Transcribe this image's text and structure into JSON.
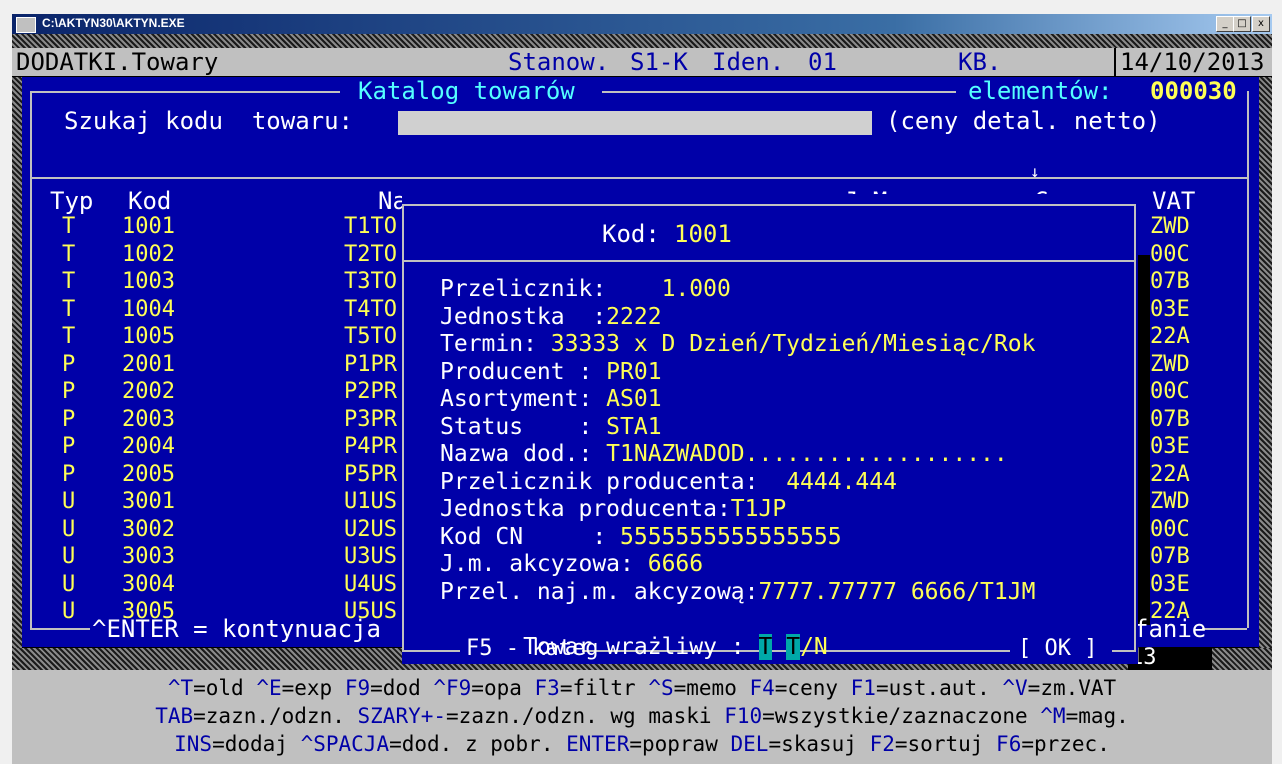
{
  "window": {
    "title": "C:\\AKTYN30\\AKTYN.EXE",
    "minimize_label": "_",
    "maximize_label": "□",
    "close_label": "x"
  },
  "status_bar": {
    "module": "DODATKI.Towary",
    "station_label": "Stanow.",
    "station": "S1-K",
    "iden_label": "Iden.",
    "iden": "01",
    "user": "KB.",
    "date": "14/10/2013"
  },
  "catalog": {
    "title": "Katalog towarów",
    "elements_label": "elementów:",
    "elements_count": "000030",
    "search_label": "Szukaj kodu  towaru:",
    "search_value": "",
    "price_mode": "(ceny detal. netto)",
    "sort_arrow": "↓",
    "footer_hint": "^ENTER = kontynuacja",
    "footer_right": "fanie",
    "columns": {
      "typ": "Typ",
      "kod": "Kod",
      "nazwa": "Nazwa",
      "jm": "J.M.",
      "cena": "Cena",
      "vat": "VAT"
    },
    "rows": [
      {
        "typ": "T",
        "kod": "1001",
        "nazwa": "T1TO",
        "vat": "ZWD"
      },
      {
        "typ": "T",
        "kod": "1002",
        "nazwa": "T2TO",
        "vat": "00C"
      },
      {
        "typ": "T",
        "kod": "1003",
        "nazwa": "T3TO",
        "vat": "07B"
      },
      {
        "typ": "T",
        "kod": "1004",
        "nazwa": "T4TO",
        "vat": "03E"
      },
      {
        "typ": "T",
        "kod": "1005",
        "nazwa": "T5TO",
        "vat": "22A"
      },
      {
        "typ": "P",
        "kod": "2001",
        "nazwa": "P1PR",
        "vat": "ZWD"
      },
      {
        "typ": "P",
        "kod": "2002",
        "nazwa": "P2PR",
        "vat": "00C"
      },
      {
        "typ": "P",
        "kod": "2003",
        "nazwa": "P3PR",
        "vat": "07B"
      },
      {
        "typ": "P",
        "kod": "2004",
        "nazwa": "P4PR",
        "vat": "03E"
      },
      {
        "typ": "P",
        "kod": "2005",
        "nazwa": "P5PR",
        "vat": "22A"
      },
      {
        "typ": "U",
        "kod": "3001",
        "nazwa": "U1US",
        "vat": "ZWD"
      },
      {
        "typ": "U",
        "kod": "3002",
        "nazwa": "U2US",
        "vat": "00C"
      },
      {
        "typ": "U",
        "kod": "3003",
        "nazwa": "U3US",
        "vat": "07B"
      },
      {
        "typ": "U",
        "kod": "3004",
        "nazwa": "U4US",
        "vat": "03E"
      },
      {
        "typ": "U",
        "kod": "3005",
        "nazwa": "U5US",
        "vat": "22A"
      }
    ],
    "side_value": "13"
  },
  "dialog": {
    "kod_label": "Kod:",
    "kod_value": "1001",
    "fields": [
      {
        "label": "Przelicznik:    ",
        "value": "1.000"
      },
      {
        "label": "Jednostka  :",
        "value": "2222"
      },
      {
        "label": "Termin: ",
        "value": "33333 x D Dzień/Tydzień/Miesiąc/Rok"
      },
      {
        "label": "Producent : ",
        "value": "PR01"
      },
      {
        "label": "Asortyment: ",
        "value": "AS01"
      },
      {
        "label": "Status    : ",
        "value": "STA1"
      },
      {
        "label": "Nazwa dod.: ",
        "value": "T1NAZWADOD..................."
      },
      {
        "label": "Przelicznik producenta:  ",
        "value": "4444.444"
      },
      {
        "label": "Jednostka producenta:",
        "value": "T1JP"
      },
      {
        "label": "Kod CN     : ",
        "value": "5555555555555555"
      },
      {
        "label": "J.m. akcyzowa: ",
        "value": "6666"
      },
      {
        "label": "Przel. naj.m. akcyzową:",
        "value": "7777.77777 6666/T1JM"
      }
    ],
    "sensitive_label": "Towar wrażliwy : ",
    "sensitive_t1": "T",
    "sensitive_t2": "T",
    "sensitive_rest": "/N",
    "footer_left": "F5 - kateg",
    "ok_label": "[ OK ]"
  },
  "help": {
    "lines": [
      [
        {
          "k": "^T",
          "v": "=old "
        },
        {
          "k": "^E",
          "v": "=exp "
        },
        {
          "k": "F9",
          "v": "=dod "
        },
        {
          "k": "^F9",
          "v": "=opa "
        },
        {
          "k": "F3",
          "v": "=filtr "
        },
        {
          "k": "^S",
          "v": "=memo "
        },
        {
          "k": "F4",
          "v": "=ceny "
        },
        {
          "k": "F1",
          "v": "=ust.aut. "
        },
        {
          "k": "^V",
          "v": "=zm.VAT"
        }
      ],
      [
        {
          "k": "TAB",
          "v": "=zazn./odzn. "
        },
        {
          "k": "SZARY+-",
          "v": "=zazn./odzn. wg maski "
        },
        {
          "k": "F10",
          "v": "=wszystkie/zaznaczone "
        },
        {
          "k": "^M",
          "v": "=mag."
        }
      ],
      [
        {
          "k": "INS",
          "v": "=dodaj "
        },
        {
          "k": "^SPACJA",
          "v": "=dod. z pobr. "
        },
        {
          "k": "ENTER",
          "v": "=popraw "
        },
        {
          "k": "DEL",
          "v": "=skasuj "
        },
        {
          "k": "F2",
          "v": "=sortuj "
        },
        {
          "k": "F6",
          "v": "=przec."
        }
      ]
    ]
  },
  "colors": {
    "panel": "#0000a8",
    "frame": "#c0c0c0",
    "accent_text": "#ffff55",
    "title_text": "#55ffff",
    "help_key": "#0000a8"
  }
}
